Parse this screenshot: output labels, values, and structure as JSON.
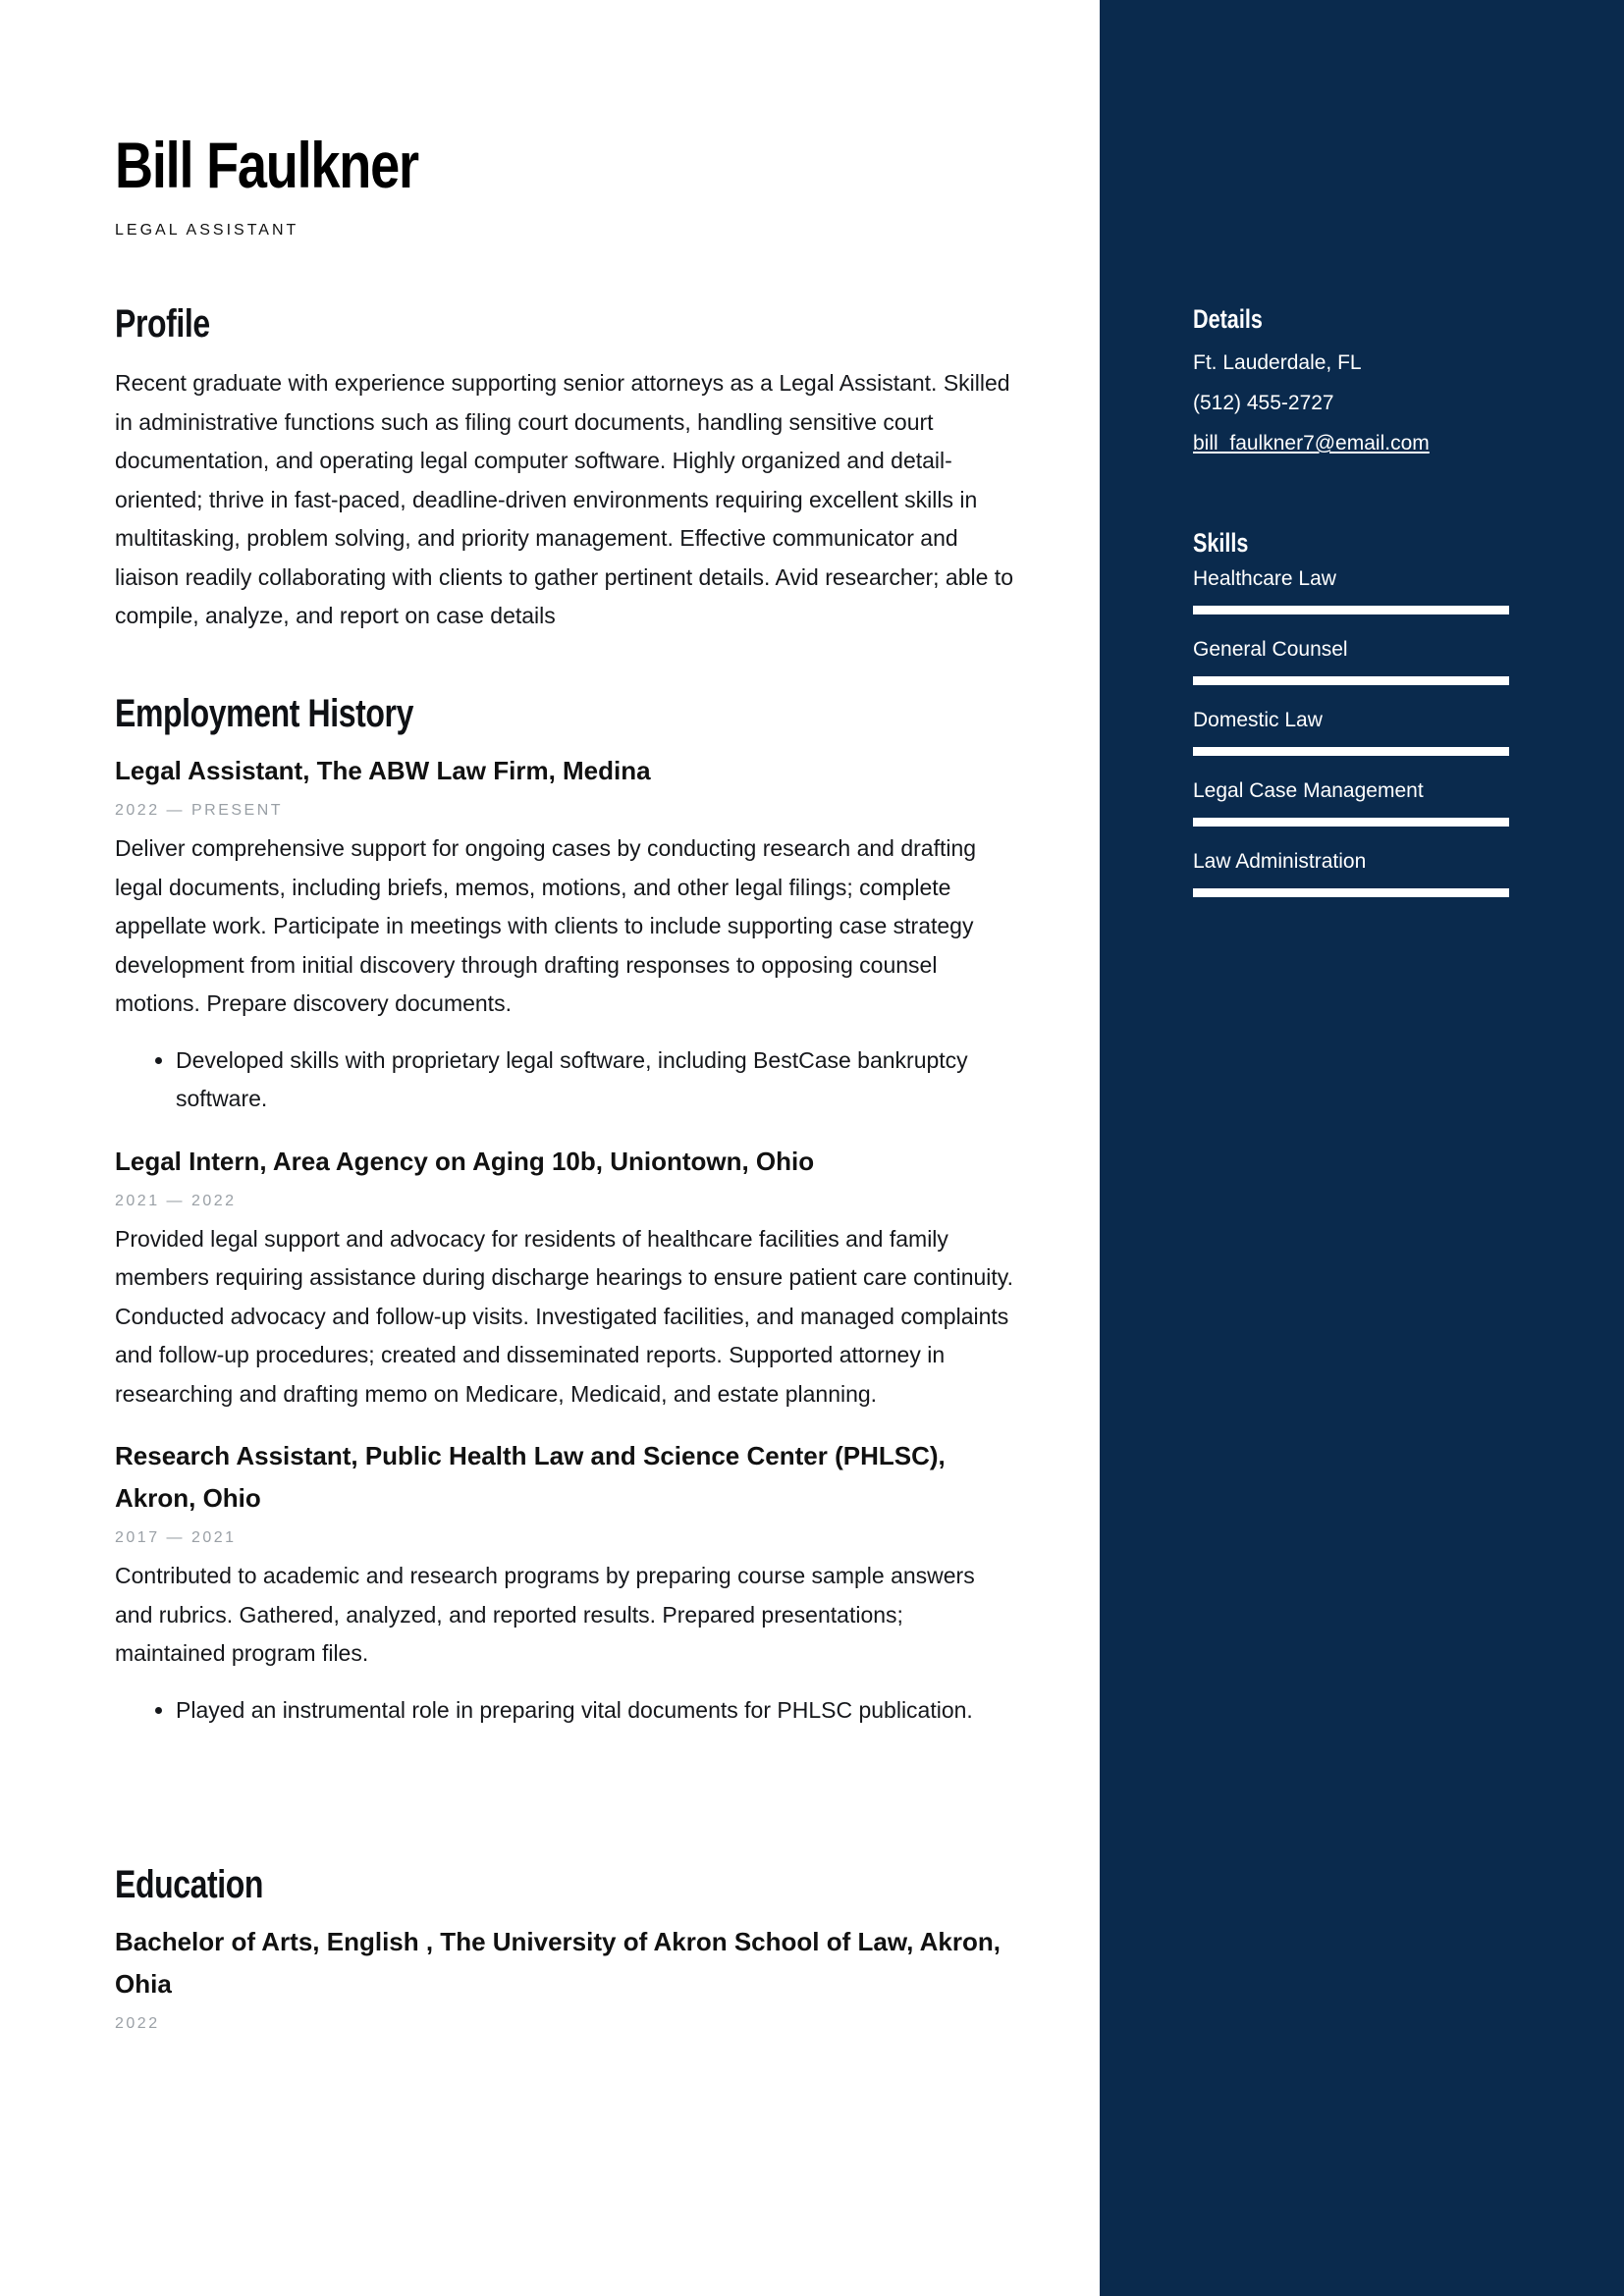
{
  "header": {
    "name": "Bill Faulkner",
    "job_title": "LEGAL ASSISTANT"
  },
  "profile": {
    "heading": "Profile",
    "text": "Recent graduate with experience supporting senior attorneys as a Legal Assistant. Skilled in administrative functions such as filing court documents, handling sensitive court documentation, and operating legal computer software. Highly organized and detail-oriented; thrive in fast-paced, deadline-driven environments requiring excellent skills in multitasking, problem solving, and priority management. Effective communicator and liaison readily collaborating with clients to gather pertinent details. Avid researcher; able to compile, analyze, and report on case details"
  },
  "employment": {
    "heading": "Employment History",
    "entries": [
      {
        "title": "Legal Assistant, The ABW Law Firm, Medina",
        "date": "2022 — PRESENT",
        "description": "Deliver comprehensive support for ongoing cases by conducting research and drafting legal documents, including briefs, memos, motions, and other legal filings; complete appellate work. Participate in meetings with clients to include supporting case strategy development from initial discovery through drafting responses to opposing counsel motions. Prepare discovery documents.",
        "bullets": [
          "Developed skills with proprietary legal software, including BestCase bankruptcy software."
        ]
      },
      {
        "title": "Legal Intern, Area Agency on Aging 10b, Uniontown, Ohio",
        "date": "2021 — 2022",
        "description": "Provided legal support and advocacy for residents of healthcare facilities and family members requiring assistance during discharge hearings to ensure patient care continuity. Conducted advocacy and follow-up visits. Investigated facilities, and managed complaints and follow-up procedures; created and disseminated reports. Supported attorney in researching and drafting memo on Medicare, Medicaid, and estate planning.",
        "bullets": []
      },
      {
        "title": "Research Assistant, Public Health Law and Science Center (PHLSC), Akron, Ohio",
        "date": "2017 — 2021",
        "description": "Contributed to academic and research programs by preparing course sample answers and rubrics. Gathered, analyzed, and reported results. Prepared presentations; maintained program files.",
        "bullets": [
          "Played an instrumental role in preparing vital documents for PHLSC publication."
        ]
      }
    ]
  },
  "education": {
    "heading": "Education",
    "entries": [
      {
        "title": "Bachelor of Arts, English , The University of Akron School of Law, Akron, Ohia",
        "date": "2022"
      }
    ]
  },
  "sidebar": {
    "background_color": "#0a2a4d",
    "details": {
      "heading": "Details",
      "location": "Ft. Lauderdale, FL",
      "phone": "(512) 455-2727",
      "email": "bill_faulkner7@email.com"
    },
    "skills": {
      "heading": "Skills",
      "items": [
        {
          "label": "Healthcare Law",
          "level_percent": 100
        },
        {
          "label": "General Counsel",
          "level_percent": 100
        },
        {
          "label": "Domestic Law",
          "level_percent": 100
        },
        {
          "label": "Legal Case Management",
          "level_percent": 100
        },
        {
          "label": "Law Administration",
          "level_percent": 100
        }
      ]
    }
  }
}
